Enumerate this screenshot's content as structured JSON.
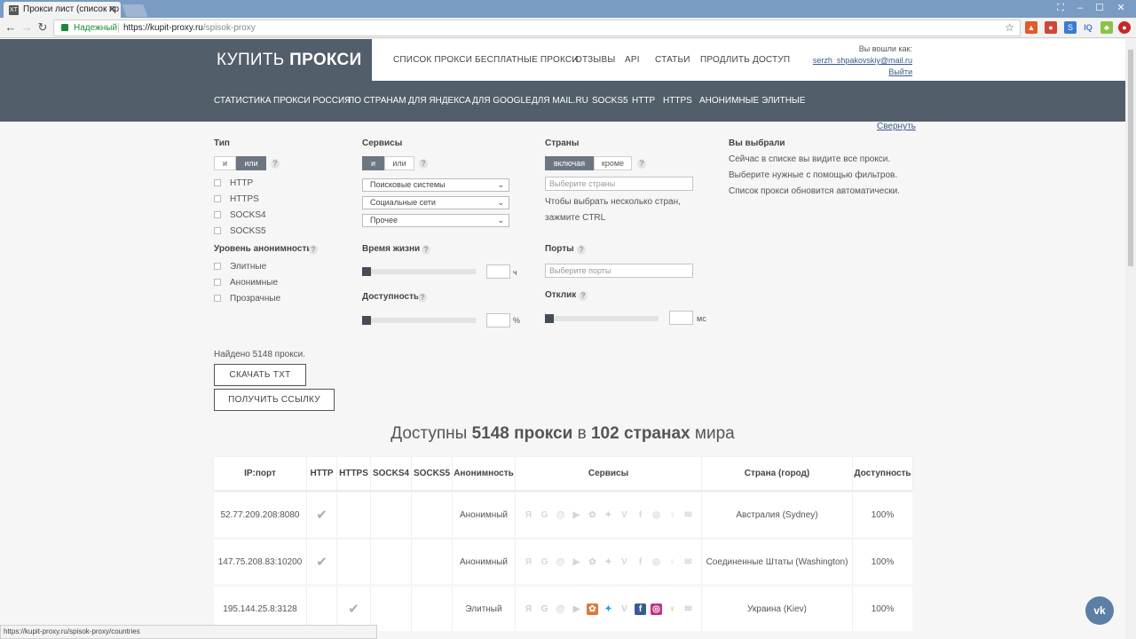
{
  "browser": {
    "tab_title": "Прокси лист (список пр",
    "tab_favicon": "XT",
    "secure_label": "Надежный",
    "url_host": "https://kupit-proxy.ru",
    "url_path": "/spisok-proxy",
    "status_url": "https://kupit-proxy.ru/spisok-proxy/countries"
  },
  "site": {
    "logo_light": "КУПИТЬ",
    "logo_bold": "ПРОКСИ",
    "top_nav": [
      "СПИСОК ПРОКСИ",
      "БЕСПЛАТНЫЕ ПРОКСИ",
      "ОТЗЫВЫ",
      "API",
      "СТАТЬИ",
      "ПРОДЛИТЬ ДОСТУП"
    ],
    "user_label": "Вы вошли как:",
    "user_email": "serzh_shpakovskiy@mail.ru",
    "logout": "Выйти",
    "sub_nav": [
      "СТАТИСТИКА",
      "ПРОКСИ РОССИЯ",
      "ПО СТРАНАМ",
      "ДЛЯ ЯНДЕКСА",
      "ДЛЯ GOOGLE",
      "ДЛЯ MAIL.RU",
      "SOCKS5",
      "HTTP",
      "HTTPS",
      "АНОНИМНЫЕ",
      "ЭЛИТНЫЕ"
    ],
    "collapse": "Свернуть"
  },
  "filters": {
    "type_label": "Тип",
    "and": "и",
    "or": "или",
    "types": [
      "HTTP",
      "HTTPS",
      "SOCKS4",
      "SOCKS5"
    ],
    "anon_label": "Уровень анонимности",
    "anon_levels": [
      "Элитные",
      "Анонимные",
      "Прозрачные"
    ],
    "services_label": "Сервисы",
    "service_selects": [
      "Поисковые системы",
      "Социальные сети",
      "Прочее"
    ],
    "lifetime_label": "Время жизни",
    "lifetime_unit": "ч",
    "avail_label": "Доступность",
    "avail_unit": "%",
    "countries_label": "Страны",
    "include": "включая",
    "except": "кроме",
    "countries_placeholder": "Выберите страны",
    "countries_hint_1": "Чтобы выбрать несколько стран,",
    "countries_hint_2": "зажмите CTRL",
    "ports_label": "Порты",
    "ports_placeholder": "Выберите порты",
    "response_label": "Отклик",
    "response_unit": "мс",
    "chosen_label": "Вы выбрали",
    "chosen_lines": [
      "Сейчас в списке вы видите все прокси.",
      "Выберите нужные с помощью фильтров.",
      "Список прокси обновится автоматически."
    ]
  },
  "results": {
    "found": "Найдено 5148 прокси.",
    "download_btn": "СКАЧАТЬ TXT",
    "link_btn": "ПОЛУЧИТЬ ССЫЛКУ",
    "headline_pre": "Доступны ",
    "headline_count": "5148 прокси",
    "headline_mid": " в ",
    "headline_countries": "102 странах",
    "headline_post": " мира"
  },
  "table": {
    "headers": [
      "IP:порт",
      "HTTP",
      "HTTPS",
      "SOCKS4",
      "SOCKS5",
      "Анонимность",
      "Сервисы",
      "Страна (город)",
      "Доступность"
    ],
    "rows": [
      {
        "ip": "52.77.209.208:8080",
        "http": "✔",
        "https": "",
        "anon": "Анонимный",
        "country": "Австралия (Sydney)",
        "avail": "100%",
        "colored": false
      },
      {
        "ip": "147.75.208.83:10200",
        "http": "✔",
        "https": "",
        "anon": "Анонимный",
        "country": "Соединенные Штаты (Washington)",
        "avail": "100%",
        "colored": false
      },
      {
        "ip": "195.144.25.8:3128",
        "http": "",
        "https": "✔",
        "anon": "Элитный",
        "country": "Украина (Kiev)",
        "avail": "100%",
        "colored": true
      }
    ],
    "service_icons": [
      "yandex-icon",
      "google-icon",
      "mail-at-icon",
      "play-icon",
      "flower-icon",
      "twitter-icon",
      "vk-icon",
      "facebook-icon",
      "instagram-icon",
      "odnoklassniki-icon",
      "envelope-icon"
    ],
    "service_colors": [
      "",
      "",
      "",
      "",
      "#e2763a",
      "#1da1f2",
      "",
      "#3b5998",
      "#c13584",
      "#f39c12",
      ""
    ]
  },
  "widgets": {
    "vk_label": "vk"
  }
}
